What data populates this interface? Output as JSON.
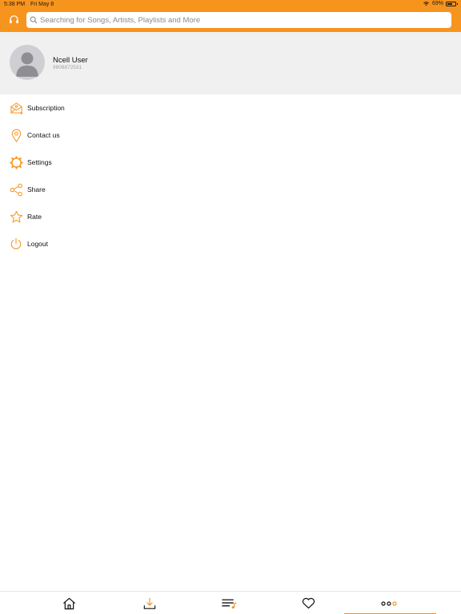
{
  "status_bar": {
    "time": "5:38 PM",
    "date": "Fri May 8",
    "battery": "69%",
    "battery_level": 0.69
  },
  "search": {
    "placeholder": "Searching for Songs, Artists, Playlists and More"
  },
  "profile": {
    "name": "Ncell User",
    "phone": "9808872531"
  },
  "menu": {
    "items": [
      {
        "label": "Subscription",
        "icon": "subscription-icon"
      },
      {
        "label": "Contact us",
        "icon": "location-pin-icon"
      },
      {
        "label": "Settings",
        "icon": "gear-icon"
      },
      {
        "label": "Share",
        "icon": "share-icon"
      },
      {
        "label": "Rate",
        "icon": "star-icon"
      },
      {
        "label": "Logout",
        "icon": "power-icon"
      }
    ]
  },
  "bottom_nav": {
    "items": [
      {
        "icon": "home-icon"
      },
      {
        "icon": "download-icon"
      },
      {
        "icon": "playlist-icon"
      },
      {
        "icon": "heart-icon"
      },
      {
        "icon": "more-icon",
        "active": true
      }
    ]
  },
  "colors": {
    "accent": "#f7941d",
    "profile_bg": "#f0f0f0",
    "text": "#111111"
  }
}
